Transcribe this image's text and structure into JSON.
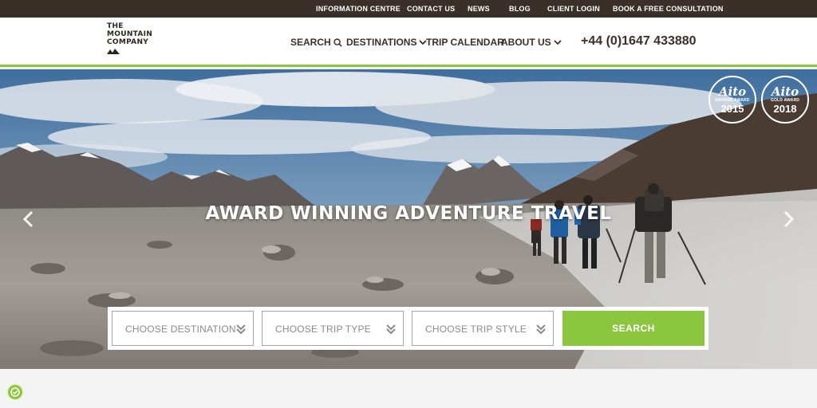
{
  "topbar": {
    "links": [
      {
        "label": "INFORMATION CENTRE"
      },
      {
        "label": "CONTACT US"
      },
      {
        "label": "NEWS"
      },
      {
        "label": "BLOG"
      },
      {
        "label": "CLIENT LOGIN"
      },
      {
        "label": "BOOK A FREE CONSULTATION"
      }
    ]
  },
  "header": {
    "logo_lines": [
      "THE",
      "MOUNTAIN",
      "COMPANY"
    ],
    "nav": [
      {
        "label": "SEARCH",
        "icon": "search-icon"
      },
      {
        "label": "DESTINATIONS",
        "icon": "chevron-down-icon"
      },
      {
        "label": "TRIP CALENDAR"
      },
      {
        "label": "ABOUT US",
        "icon": "chevron-down-icon"
      }
    ],
    "phone": "+44 (0)1647 433880"
  },
  "hero": {
    "title": "AWARD WINNING ADVENTURE TRAVEL",
    "badges": [
      {
        "logo": "Aito",
        "award": "BRONZE AWARD",
        "year": "2015"
      },
      {
        "logo": "Aito",
        "award": "GOLD AWARD",
        "year": "2018"
      }
    ]
  },
  "search": {
    "destination_label": "CHOOSE DESTINATION",
    "trip_type_label": "CHOOSE TRIP TYPE",
    "trip_style_label": "CHOOSE TRIP STYLE",
    "button_label": "SEARCH"
  },
  "colors": {
    "brand_dark": "#3b2f2a",
    "accent_green": "#8cc63f"
  }
}
